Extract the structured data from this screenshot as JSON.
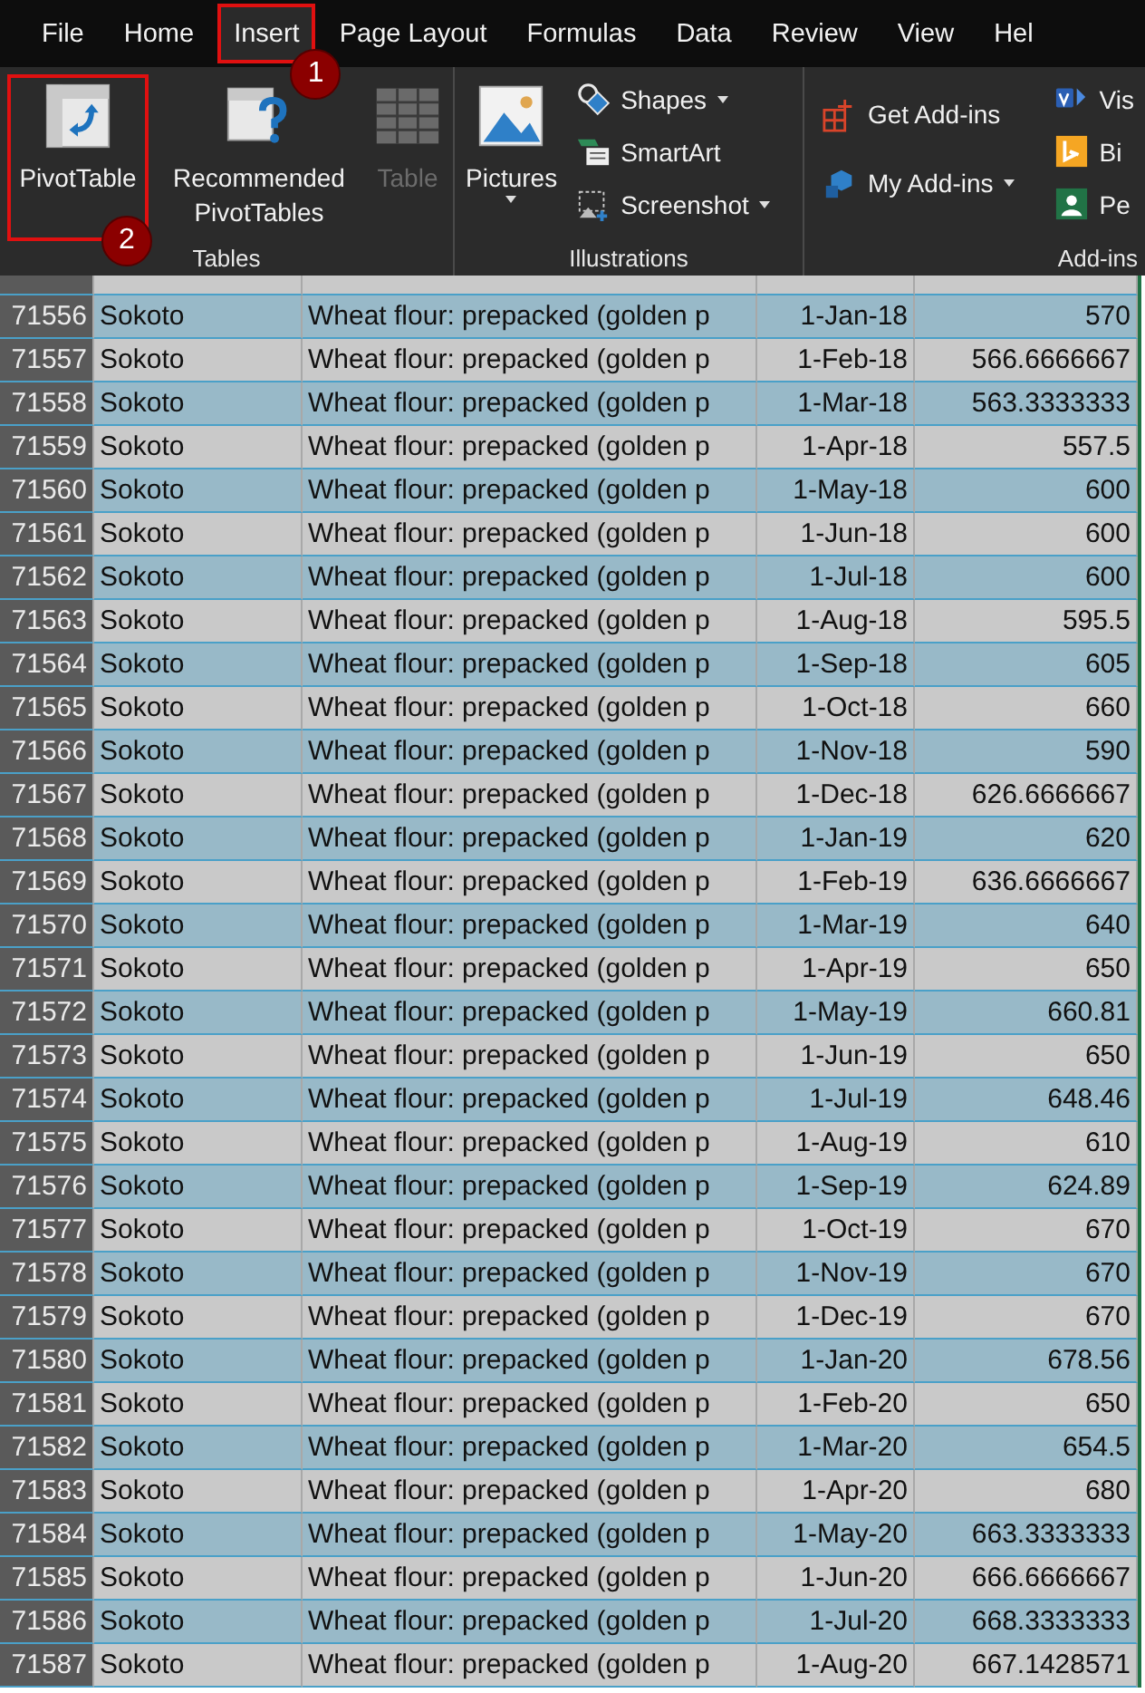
{
  "menu_tabs": [
    {
      "label": "File",
      "selected": false
    },
    {
      "label": "Home",
      "selected": false
    },
    {
      "label": "Insert",
      "selected": true,
      "badge": "1"
    },
    {
      "label": "Page Layout",
      "selected": false
    },
    {
      "label": "Formulas",
      "selected": false
    },
    {
      "label": "Data",
      "selected": false
    },
    {
      "label": "Review",
      "selected": false
    },
    {
      "label": "View",
      "selected": false
    },
    {
      "label": "Hel",
      "selected": false
    }
  ],
  "ribbon_groups": [
    {
      "label": "Tables",
      "commands": [
        {
          "kind": "large",
          "label": "PivotTable",
          "disabled": false,
          "badge": "2"
        },
        {
          "kind": "large",
          "label": "Recommended PivotTables",
          "disabled": false
        },
        {
          "kind": "large",
          "label": "Table",
          "disabled": true
        }
      ]
    },
    {
      "label": "Illustrations",
      "commands": [
        {
          "kind": "large",
          "label": "Pictures",
          "disabled": false,
          "dropdown": true
        },
        {
          "kind": "small",
          "label": "Shapes",
          "dropdown": true
        },
        {
          "kind": "small",
          "label": "SmartArt",
          "dropdown": false
        },
        {
          "kind": "small",
          "label": "Screenshot",
          "dropdown": true
        }
      ]
    },
    {
      "label": "Add-ins",
      "commands": [
        {
          "kind": "medium",
          "label": "Get Add-ins",
          "dropdown": false
        },
        {
          "kind": "medium",
          "label": "My Add-ins",
          "dropdown": true
        },
        {
          "kind": "small",
          "label": "Vis"
        },
        {
          "kind": "small",
          "label": "Bi"
        },
        {
          "kind": "small",
          "label": "Pe"
        }
      ]
    }
  ],
  "rows": [
    {
      "num": "71556",
      "state": "Sokoto",
      "item": "Wheat flour: prepacked (golden p",
      "date": "1-Jan-18",
      "price": "570"
    },
    {
      "num": "71557",
      "state": "Sokoto",
      "item": "Wheat flour: prepacked (golden p",
      "date": "1-Feb-18",
      "price": "566.6666667"
    },
    {
      "num": "71558",
      "state": "Sokoto",
      "item": "Wheat flour: prepacked (golden p",
      "date": "1-Mar-18",
      "price": "563.3333333"
    },
    {
      "num": "71559",
      "state": "Sokoto",
      "item": "Wheat flour: prepacked (golden p",
      "date": "1-Apr-18",
      "price": "557.5"
    },
    {
      "num": "71560",
      "state": "Sokoto",
      "item": "Wheat flour: prepacked (golden p",
      "date": "1-May-18",
      "price": "600"
    },
    {
      "num": "71561",
      "state": "Sokoto",
      "item": "Wheat flour: prepacked (golden p",
      "date": "1-Jun-18",
      "price": "600"
    },
    {
      "num": "71562",
      "state": "Sokoto",
      "item": "Wheat flour: prepacked (golden p",
      "date": "1-Jul-18",
      "price": "600"
    },
    {
      "num": "71563",
      "state": "Sokoto",
      "item": "Wheat flour: prepacked (golden p",
      "date": "1-Aug-18",
      "price": "595.5"
    },
    {
      "num": "71564",
      "state": "Sokoto",
      "item": "Wheat flour: prepacked (golden p",
      "date": "1-Sep-18",
      "price": "605"
    },
    {
      "num": "71565",
      "state": "Sokoto",
      "item": "Wheat flour: prepacked (golden p",
      "date": "1-Oct-18",
      "price": "660"
    },
    {
      "num": "71566",
      "state": "Sokoto",
      "item": "Wheat flour: prepacked (golden p",
      "date": "1-Nov-18",
      "price": "590"
    },
    {
      "num": "71567",
      "state": "Sokoto",
      "item": "Wheat flour: prepacked (golden p",
      "date": "1-Dec-18",
      "price": "626.6666667"
    },
    {
      "num": "71568",
      "state": "Sokoto",
      "item": "Wheat flour: prepacked (golden p",
      "date": "1-Jan-19",
      "price": "620"
    },
    {
      "num": "71569",
      "state": "Sokoto",
      "item": "Wheat flour: prepacked (golden p",
      "date": "1-Feb-19",
      "price": "636.6666667"
    },
    {
      "num": "71570",
      "state": "Sokoto",
      "item": "Wheat flour: prepacked (golden p",
      "date": "1-Mar-19",
      "price": "640"
    },
    {
      "num": "71571",
      "state": "Sokoto",
      "item": "Wheat flour: prepacked (golden p",
      "date": "1-Apr-19",
      "price": "650"
    },
    {
      "num": "71572",
      "state": "Sokoto",
      "item": "Wheat flour: prepacked (golden p",
      "date": "1-May-19",
      "price": "660.81"
    },
    {
      "num": "71573",
      "state": "Sokoto",
      "item": "Wheat flour: prepacked (golden p",
      "date": "1-Jun-19",
      "price": "650"
    },
    {
      "num": "71574",
      "state": "Sokoto",
      "item": "Wheat flour: prepacked (golden p",
      "date": "1-Jul-19",
      "price": "648.46"
    },
    {
      "num": "71575",
      "state": "Sokoto",
      "item": "Wheat flour: prepacked (golden p",
      "date": "1-Aug-19",
      "price": "610"
    },
    {
      "num": "71576",
      "state": "Sokoto",
      "item": "Wheat flour: prepacked (golden p",
      "date": "1-Sep-19",
      "price": "624.89"
    },
    {
      "num": "71577",
      "state": "Sokoto",
      "item": "Wheat flour: prepacked (golden p",
      "date": "1-Oct-19",
      "price": "670"
    },
    {
      "num": "71578",
      "state": "Sokoto",
      "item": "Wheat flour: prepacked (golden p",
      "date": "1-Nov-19",
      "price": "670"
    },
    {
      "num": "71579",
      "state": "Sokoto",
      "item": "Wheat flour: prepacked (golden p",
      "date": "1-Dec-19",
      "price": "670"
    },
    {
      "num": "71580",
      "state": "Sokoto",
      "item": "Wheat flour: prepacked (golden p",
      "date": "1-Jan-20",
      "price": "678.56"
    },
    {
      "num": "71581",
      "state": "Sokoto",
      "item": "Wheat flour: prepacked (golden p",
      "date": "1-Feb-20",
      "price": "650"
    },
    {
      "num": "71582",
      "state": "Sokoto",
      "item": "Wheat flour: prepacked (golden p",
      "date": "1-Mar-20",
      "price": "654.5"
    },
    {
      "num": "71583",
      "state": "Sokoto",
      "item": "Wheat flour: prepacked (golden p",
      "date": "1-Apr-20",
      "price": "680"
    },
    {
      "num": "71584",
      "state": "Sokoto",
      "item": "Wheat flour: prepacked (golden p",
      "date": "1-May-20",
      "price": "663.3333333"
    },
    {
      "num": "71585",
      "state": "Sokoto",
      "item": "Wheat flour: prepacked (golden p",
      "date": "1-Jun-20",
      "price": "666.6666667"
    },
    {
      "num": "71586",
      "state": "Sokoto",
      "item": "Wheat flour: prepacked (golden p",
      "date": "1-Jul-20",
      "price": "668.3333333"
    },
    {
      "num": "71587",
      "state": "Sokoto",
      "item": "Wheat flour: prepacked (golden p",
      "date": "1-Aug-20",
      "price": "667.1428571"
    }
  ]
}
